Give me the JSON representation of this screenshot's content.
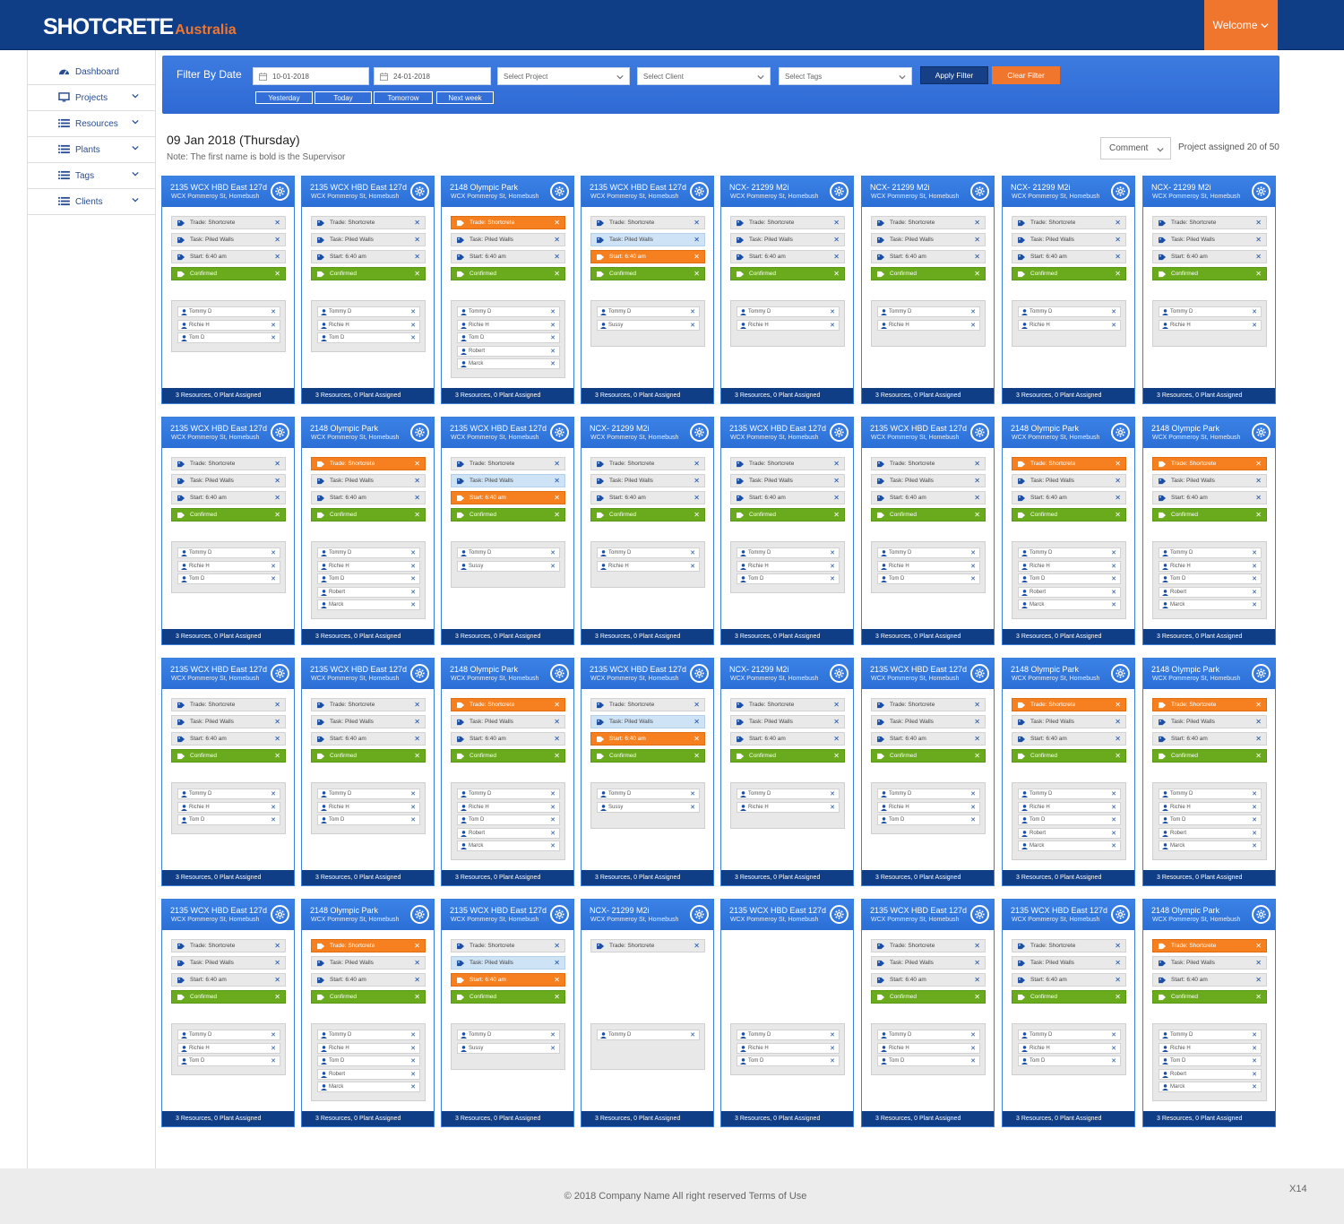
{
  "brand": {
    "name": "SHOTCRETE",
    "suffix": "Australia"
  },
  "header": {
    "welcome_label": "Welcome"
  },
  "sidebar": {
    "items": [
      {
        "label": "Dashboard",
        "icon": "dashboard-icon",
        "has_chevron": false
      },
      {
        "label": "Projects",
        "icon": "monitor-icon",
        "has_chevron": true
      },
      {
        "label": "Resources",
        "icon": "list-icon",
        "has_chevron": true
      },
      {
        "label": "Plants",
        "icon": "list-icon",
        "has_chevron": true
      },
      {
        "label": "Tags",
        "icon": "list-icon",
        "has_chevron": true
      },
      {
        "label": "Clients",
        "icon": "list-icon",
        "has_chevron": true
      }
    ]
  },
  "filter": {
    "title": "Filter By Date",
    "date_from": "10-01-2018",
    "date_to": "24-01-2018",
    "project_placeholder": "Select Project",
    "client_placeholder": "Select Client",
    "tags_placeholder": "Select Tags",
    "apply_label": "Apply Filter",
    "clear_label": "Clear Filter",
    "quick": [
      "Yesterday",
      "Today",
      "Tomorrow",
      "Next week"
    ]
  },
  "main": {
    "date_title": "09 Jan 2018 (Thursday)",
    "note": "Note: The first name is bold  is the Supervisor",
    "comment_label": "Comment",
    "assigned_text": "Project assigned 20 of 50"
  },
  "card_text": {
    "trade": "Trade: Shortcrete",
    "task": "Task: Piled Walls",
    "start": "Start: 6:40 am",
    "status": "Confirmed",
    "footer": "3 Resources, 0 Plant Assigned"
  },
  "colors": {
    "header": "#0f3d86",
    "accent": "#f0762e",
    "card_blue": "#2f6fd6",
    "confirmed": "#6aab1d",
    "orange_tag": "#f6801f"
  },
  "cards": [
    {
      "title": "2135 WCX HBD East 127d",
      "address": "WCX Pommeroy St, Homebush",
      "variant": "normal",
      "people": [
        "Tommy D",
        "Richie H",
        "Tom D"
      ]
    },
    {
      "title": "2135 WCX HBD East 127d",
      "address": "WCX Pommeroy St, Homebush",
      "variant": "normal",
      "people": [
        "Tommy D",
        "Richie H",
        "Tom D"
      ]
    },
    {
      "title": "2148 Olympic Park",
      "address": "WCX Pommeroy St, Homebush",
      "variant": "trade-orange",
      "people": [
        "Tommy D",
        "Richie H",
        "Tom D",
        "Robert",
        "Marck"
      ]
    },
    {
      "title": "2135 WCX HBD East 127d",
      "address": "WCX Pommeroy St, Homebush",
      "variant": "start-orange",
      "people": [
        "Tommy D",
        "Sussy"
      ]
    },
    {
      "title": "NCX- 21299 M2i",
      "address": "WCX Pommeroy St, Homebush",
      "variant": "normal",
      "people": [
        "Tommy D",
        "Richie H"
      ]
    },
    {
      "title": "NCX- 21299 M2i",
      "address": "WCX Pommeroy St, Homebush",
      "variant": "normal",
      "people": [
        "Tommy D",
        "Richie H"
      ]
    },
    {
      "title": "NCX- 21299 M2i",
      "address": "WCX Pommeroy St, Homebush",
      "variant": "normal",
      "people": [
        "Tommy D",
        "Richie H"
      ]
    },
    {
      "title": "NCX- 21299 M2i",
      "address": "WCX Pommeroy St, Homebush",
      "variant": "normal",
      "people": [
        "Tommy D",
        "Richie H"
      ]
    },
    {
      "title": "2135 WCX HBD East 127d",
      "address": "WCX Pommeroy St, Homebush",
      "variant": "normal",
      "people": [
        "Tommy D",
        "Richie H",
        "Tom D"
      ]
    },
    {
      "title": "2148 Olympic Park",
      "address": "WCX Pommeroy St, Homebush",
      "variant": "trade-orange",
      "people": [
        "Tommy D",
        "Richie H",
        "Tom D",
        "Robert",
        "Marck"
      ]
    },
    {
      "title": "2135 WCX HBD East 127d",
      "address": "WCX Pommeroy St, Homebush",
      "variant": "start-orange",
      "people": [
        "Tommy D",
        "Sussy"
      ]
    },
    {
      "title": "NCX- 21299 M2i",
      "address": "WCX Pommeroy St, Homebush",
      "variant": "normal",
      "people": [
        "Tommy D",
        "Richie H"
      ]
    },
    {
      "title": "2135 WCX HBD East 127d",
      "address": "WCX Pommeroy St, Homebush",
      "variant": "normal",
      "people": [
        "Tommy D",
        "Richie H",
        "Tom D"
      ]
    },
    {
      "title": "2135 WCX HBD East 127d",
      "address": "WCX Pommeroy St, Homebush",
      "variant": "normal",
      "people": [
        "Tommy D",
        "Richie H",
        "Tom D"
      ]
    },
    {
      "title": "2148 Olympic Park",
      "address": "WCX Pommeroy St, Homebush",
      "variant": "trade-orange",
      "people": [
        "Tommy D",
        "Richie H",
        "Tom D",
        "Robert",
        "Marck"
      ]
    },
    {
      "title": "2148 Olympic Park",
      "address": "WCX Pommeroy St, Homebush",
      "variant": "trade-orange",
      "people": [
        "Tommy D",
        "Richie H",
        "Tom D",
        "Robert",
        "Marck"
      ]
    },
    {
      "title": "2135 WCX HBD East 127d",
      "address": "WCX Pommeroy St, Homebush",
      "variant": "normal",
      "people": [
        "Tommy D",
        "Richie H",
        "Tom D"
      ]
    },
    {
      "title": "2135 WCX HBD East 127d",
      "address": "WCX Pommeroy St, Homebush",
      "variant": "normal",
      "people": [
        "Tommy D",
        "Richie H",
        "Tom D"
      ]
    },
    {
      "title": "2148 Olympic Park",
      "address": "WCX Pommeroy St, Homebush",
      "variant": "trade-orange",
      "people": [
        "Tommy D",
        "Richie H",
        "Tom D",
        "Robert",
        "Marck"
      ]
    },
    {
      "title": "2135 WCX HBD East 127d",
      "address": "WCX Pommeroy St, Homebush",
      "variant": "start-orange",
      "people": [
        "Tommy D",
        "Sussy"
      ]
    },
    {
      "title": "NCX- 21299 M2i",
      "address": "WCX Pommeroy St, Homebush",
      "variant": "normal",
      "people": [
        "Tommy D",
        "Richie H"
      ]
    },
    {
      "title": "2135 WCX HBD East 127d",
      "address": "WCX Pommeroy St, Homebush",
      "variant": "normal",
      "people": [
        "Tommy D",
        "Richie H",
        "Tom D"
      ]
    },
    {
      "title": "2148 Olympic Park",
      "address": "WCX Pommeroy St, Homebush",
      "variant": "trade-orange",
      "people": [
        "Tommy D",
        "Richie H",
        "Tom D",
        "Robert",
        "Marck"
      ]
    },
    {
      "title": "2148 Olympic Park",
      "address": "WCX Pommeroy St, Homebush",
      "variant": "trade-orange",
      "people": [
        "Tommy D",
        "Richie H",
        "Tom D",
        "Robert",
        "Marck"
      ]
    },
    {
      "title": "2135 WCX HBD East 127d",
      "address": "WCX Pommeroy St, Homebush",
      "variant": "normal",
      "people": [
        "Tommy D",
        "Richie H",
        "Tom D"
      ]
    },
    {
      "title": "2148 Olympic Park",
      "address": "WCX Pommeroy St, Homebush",
      "variant": "trade-orange",
      "people": [
        "Tommy D",
        "Richie H",
        "Tom D",
        "Robert",
        "Marck"
      ]
    },
    {
      "title": "2135 WCX HBD East 127d",
      "address": "WCX Pommeroy St, Homebush",
      "variant": "start-orange",
      "people": [
        "Tommy D",
        "Sussy"
      ]
    },
    {
      "title": "NCX- 21299 M2i",
      "address": "WCX Pommeroy St, Homebush",
      "variant": "trade-only",
      "people": [
        "Tommy D"
      ]
    },
    {
      "title": "2135 WCX HBD East 127d",
      "address": "WCX Pommeroy St, Homebush",
      "variant": "empty",
      "people": [
        "Tommy D",
        "Richie H",
        "Tom D"
      ]
    },
    {
      "title": "2135 WCX HBD East 127d",
      "address": "WCX Pommeroy St, Homebush",
      "variant": "normal",
      "people": [
        "Tommy D",
        "Richie H",
        "Tom D"
      ]
    },
    {
      "title": "2135 WCX HBD East 127d",
      "address": "WCX Pommeroy St, Homebush",
      "variant": "normal",
      "people": [
        "Tommy D",
        "Richie H",
        "Tom D"
      ]
    },
    {
      "title": "2148 Olympic Park",
      "address": "WCX Pommeroy St, Homebush",
      "variant": "trade-orange",
      "people": [
        "Tommy D",
        "Richie H",
        "Tom D",
        "Robert",
        "Marck"
      ]
    }
  ],
  "footer": {
    "copyright": "© 2018 Company Name  All right reserved  Terms of Use",
    "badge": "X14"
  }
}
